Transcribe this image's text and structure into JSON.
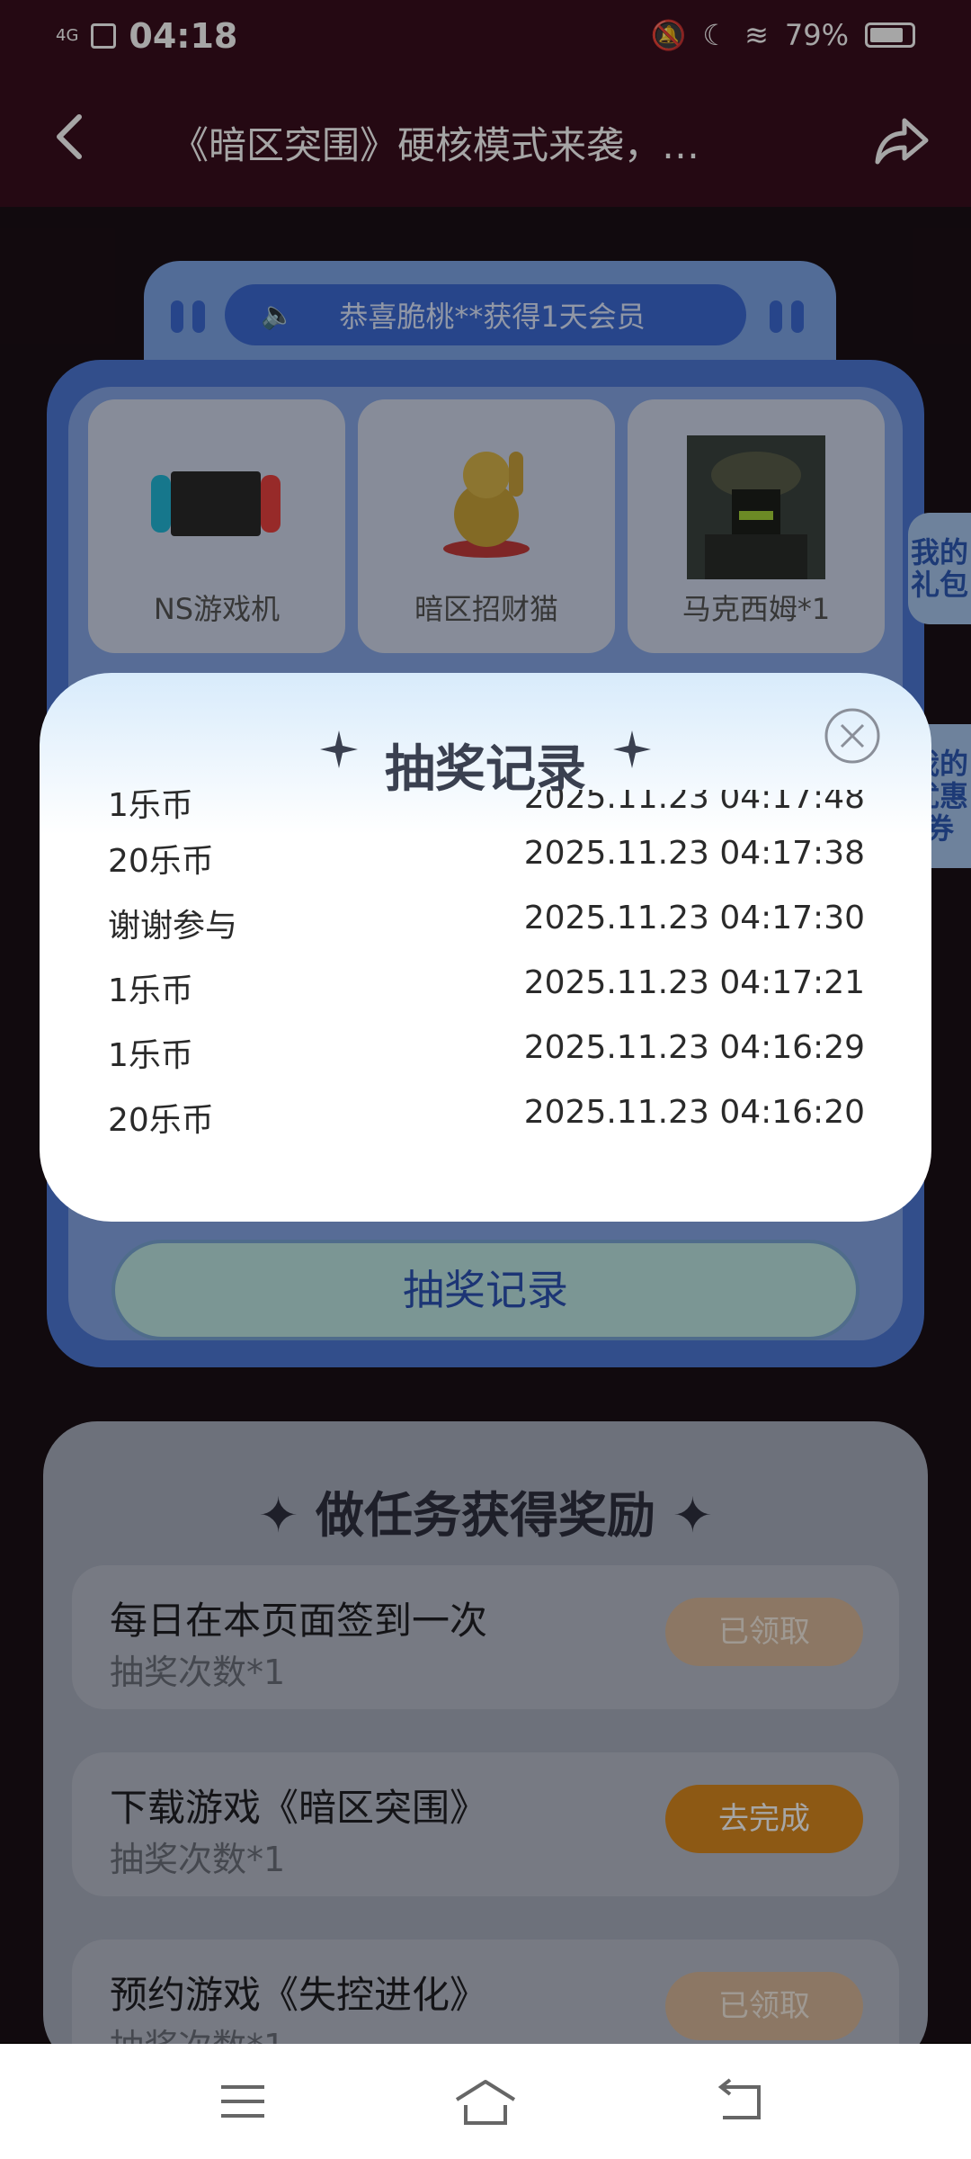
{
  "status_bar": {
    "network": "4G",
    "time": "04:18",
    "battery": "79%"
  },
  "header": {
    "title": "《暗区突围》硬核模式来袭，…"
  },
  "marquee": {
    "text": "恭喜脆桃**获得1天会员"
  },
  "prizes": [
    {
      "label": "NS游戏机"
    },
    {
      "label": "暗区招财猫"
    },
    {
      "label": "马克西姆*1"
    }
  ],
  "side_tabs": {
    "gift": "我的礼包",
    "coupon": "我的优惠券"
  },
  "record_button": {
    "label": "抽奖记录"
  },
  "tasks_section": {
    "title": "做任务获得奖励",
    "tasks": [
      {
        "name": "每日在本页面签到一次",
        "reward": "抽奖次数*1",
        "button": "已领取",
        "state": "done"
      },
      {
        "name": "下载游戏《暗区突围》",
        "reward": "抽奖次数*1",
        "button": "去完成",
        "state": "todo"
      },
      {
        "name": "预约游戏《失控进化》",
        "reward": "抽奖次数*1",
        "button": "已领取",
        "state": "done"
      }
    ]
  },
  "modal": {
    "title": "抽奖记录",
    "records": [
      {
        "prize": "1乐币",
        "time": "2025.11.23 04:17:48"
      },
      {
        "prize": "20乐币",
        "time": "2025.11.23 04:17:38"
      },
      {
        "prize": "谢谢参与",
        "time": "2025.11.23 04:17:30"
      },
      {
        "prize": "1乐币",
        "time": "2025.11.23 04:17:21"
      },
      {
        "prize": "1乐币",
        "time": "2025.11.23 04:16:29"
      },
      {
        "prize": "20乐币",
        "time": "2025.11.23 04:16:20"
      }
    ]
  },
  "colors": {
    "header_bg": "#3a0f1e",
    "accent_blue": "#3d6bd4",
    "todo_orange": "#d9891f"
  }
}
